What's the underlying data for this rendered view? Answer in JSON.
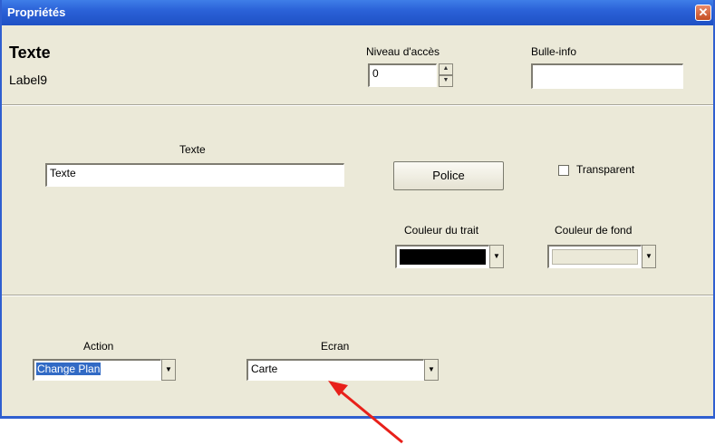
{
  "window": {
    "title": "Propriétés",
    "close_glyph": "✕"
  },
  "header": {
    "object_type": "Texte",
    "object_name": "Label9",
    "access_level": {
      "label": "Niveau d'accès",
      "value": "0",
      "up": "▲",
      "down": "▼"
    },
    "tooltip": {
      "label": "Bulle-info",
      "value": ""
    }
  },
  "text_section": {
    "text_label": "Texte",
    "text_value": "Texte",
    "font_button": "Police",
    "transparent_label": "Transparent",
    "transparent_checked": false,
    "line_color": {
      "label": "Couleur du trait",
      "color": "#000000",
      "arrow": "▼"
    },
    "bg_color": {
      "label": "Couleur de fond",
      "color": "#ebe9d8",
      "arrow": "▼"
    }
  },
  "action_section": {
    "action_label": "Action",
    "action_value": "Change Plan",
    "action_arrow": "▼",
    "screen_label": "Ecran",
    "screen_value": "Carte",
    "screen_arrow": "▼"
  },
  "annotation": {
    "arrow_color": "#e8201a"
  }
}
